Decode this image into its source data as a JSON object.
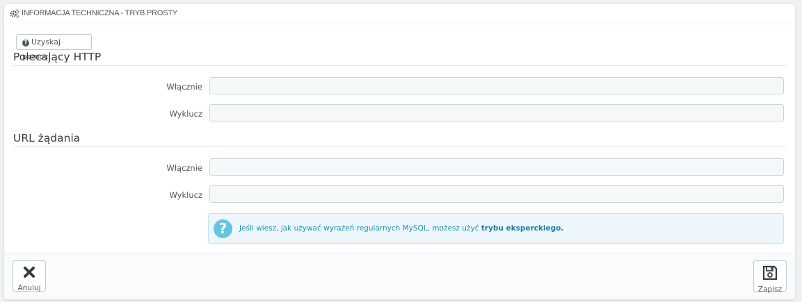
{
  "panel": {
    "title": "INFORMACJA TECHNICZNA - TRYB PROSTY",
    "heading_icon": "cogs-icon"
  },
  "help_button": {
    "label": "Uzyskaj pomoc!",
    "icon": "question-circle-icon"
  },
  "sections": [
    {
      "title": "Polecający HTTP",
      "include_label": "Włącznie",
      "exclude_label": "Wyklucz",
      "include_value": "",
      "exclude_value": ""
    },
    {
      "title": "URL żądania",
      "include_label": "Włącznie",
      "exclude_label": "Wyklucz",
      "include_value": "",
      "exclude_value": ""
    }
  ],
  "info_alert": {
    "icon": "question-icon",
    "text": "Jeśli wiesz, jak używać wyrażeń regularnych MySQL, możesz użyć ",
    "link": "trybu eksperckiego."
  },
  "footer": {
    "cancel_label": "Anuluj",
    "cancel_icon": "close-icon",
    "save_label": "Zapisz",
    "save_icon": "floppy-disk-icon"
  },
  "colors": {
    "alert_bg": "#edf7fb",
    "alert_text": "#2291b8",
    "alert_icon": "#67c4de"
  }
}
